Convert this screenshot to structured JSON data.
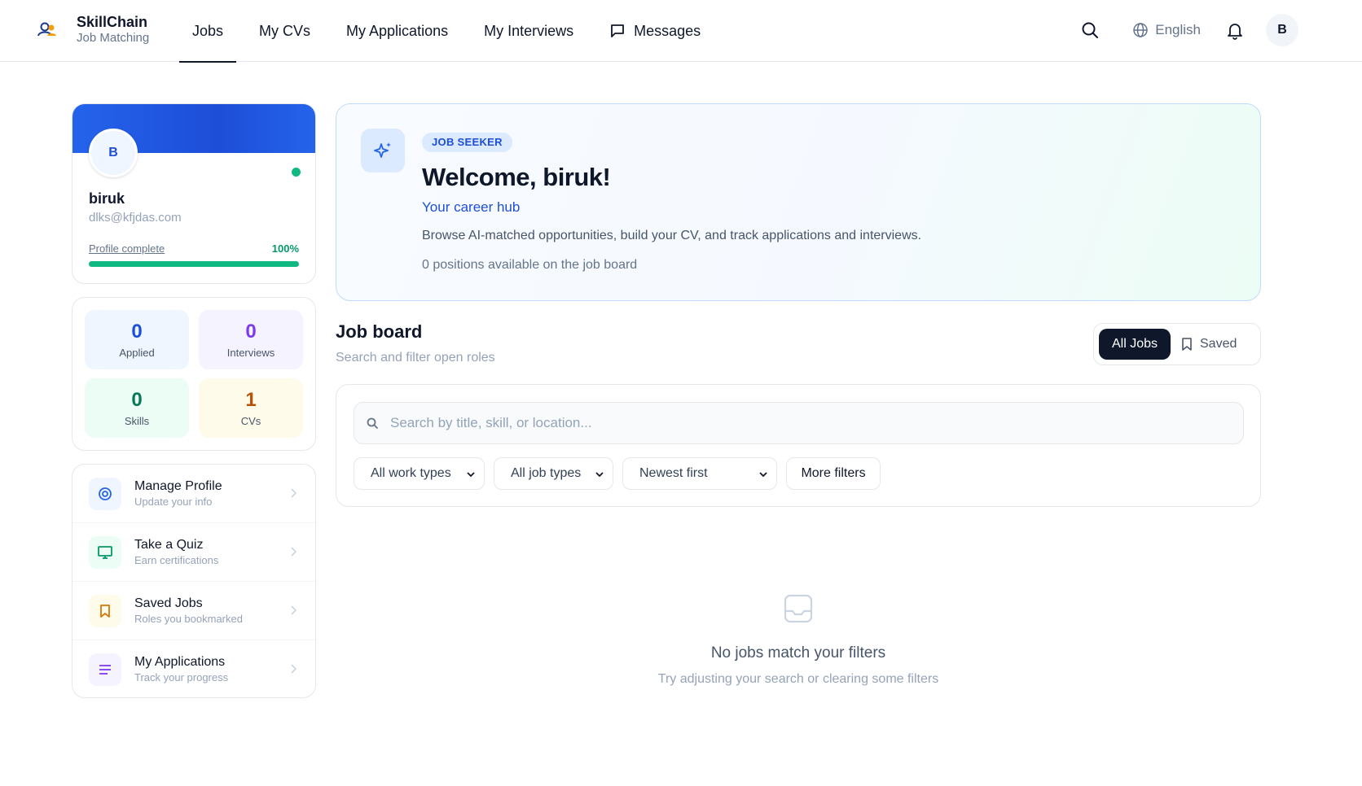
{
  "brand": {
    "name": "SkillChain",
    "subtitle": "Job Matching",
    "logo_icon": "users-logo-icon"
  },
  "nav": {
    "tabs": [
      {
        "label": "Jobs",
        "active": true
      },
      {
        "label": "My CVs"
      },
      {
        "label": "My Applications"
      },
      {
        "label": "My Interviews"
      },
      {
        "label": "Messages",
        "icon": "message-icon"
      }
    ],
    "language": "English",
    "avatar_initial": "B"
  },
  "profile": {
    "initial": "B",
    "name": "biruk",
    "email": "dlks@kfjdas.com",
    "complete_label": "Profile complete",
    "complete_pct_label": "100%",
    "complete_pct": 100
  },
  "stats": [
    {
      "value": "0",
      "label": "Applied"
    },
    {
      "value": "0",
      "label": "Interviews"
    },
    {
      "value": "0",
      "label": "Skills"
    },
    {
      "value": "1",
      "label": "CVs"
    }
  ],
  "menu": [
    {
      "title": "Manage Profile",
      "subtitle": "Update your info",
      "icon": "target-icon"
    },
    {
      "title": "Take a Quiz",
      "subtitle": "Earn certifications",
      "icon": "monitor-icon"
    },
    {
      "title": "Saved Jobs",
      "subtitle": "Roles you bookmarked",
      "icon": "bookmark-icon"
    },
    {
      "title": "My Applications",
      "subtitle": "Track your progress",
      "icon": "list-icon"
    }
  ],
  "welcome": {
    "badge": "JOB SEEKER",
    "title": "Welcome, biruk!",
    "subtitle": "Your career hub",
    "description": "Browse AI-matched opportunities, build your CV, and track applications and interviews.",
    "count_text": "0 positions available on the job board",
    "icon": "sparkles-icon"
  },
  "job_board": {
    "title": "Job board",
    "subtitle": "Search and filter open roles",
    "toggle_all": "All Jobs",
    "toggle_saved": "Saved",
    "search_placeholder": "Search by title, skill, or location...",
    "filters": {
      "work_type": "All work types",
      "job_type": "All job types",
      "sort": "Newest first",
      "more": "More filters"
    },
    "empty_title": "No jobs match your filters",
    "empty_subtitle": "Try adjusting your search or clearing some filters"
  },
  "colors": {
    "accent": "#2563eb",
    "success": "#10b981",
    "dark": "#0f172a"
  }
}
